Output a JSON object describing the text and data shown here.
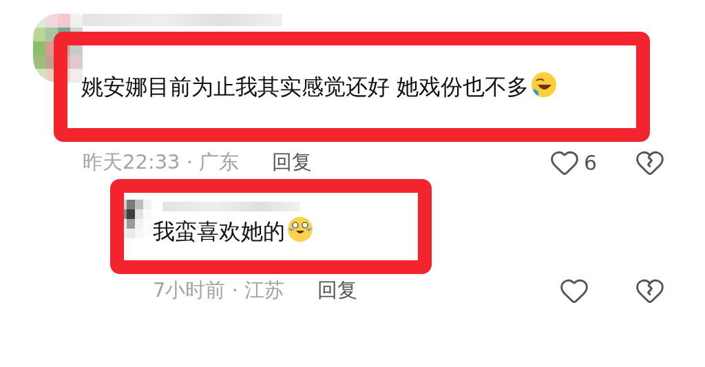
{
  "comments": [
    {
      "kind": "comment",
      "highlighted": true,
      "text": "姚安娜目前为止我其实感觉还好 她戏份也不多",
      "meta": "昨天22:33 · 广东",
      "reply": "回复",
      "likes": "6"
    },
    {
      "kind": "reply",
      "highlighted": true,
      "text": "我蛮喜欢她的",
      "meta": "7小时前 · 江苏",
      "reply": "回复"
    }
  ]
}
